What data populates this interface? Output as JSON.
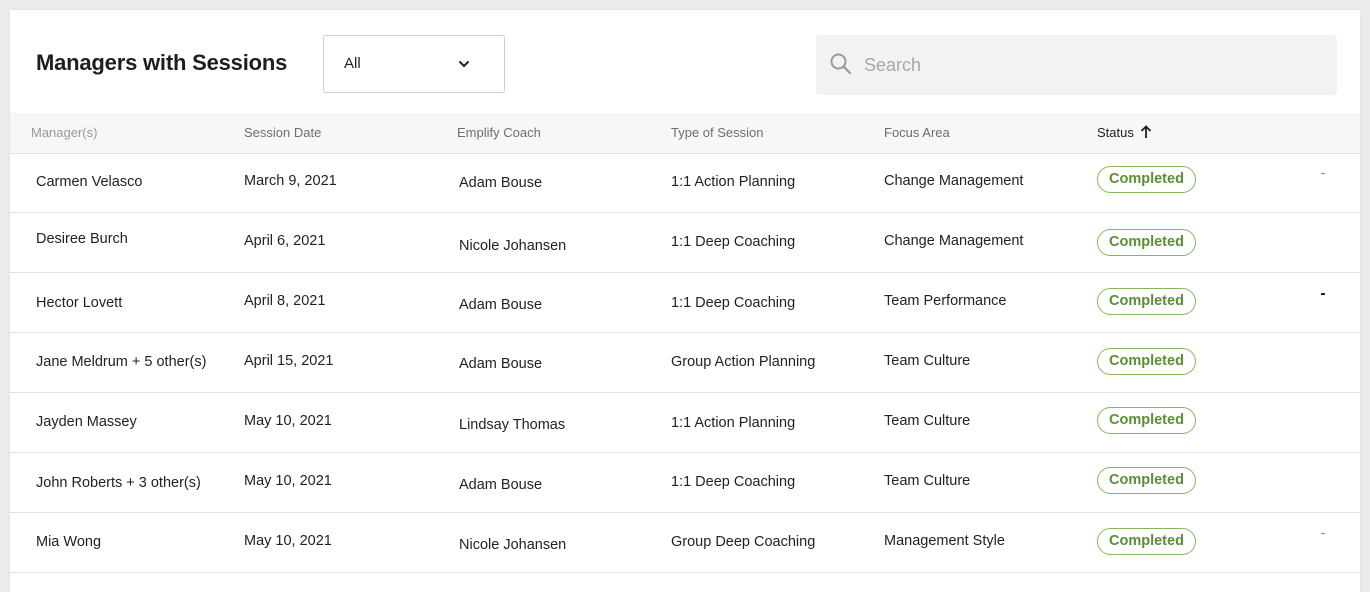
{
  "header": {
    "title": "Managers with Sessions",
    "filter": {
      "selected": "All",
      "icon": "chevron-down-icon"
    },
    "search": {
      "placeholder": "Search",
      "value": "",
      "icon": "search-icon"
    }
  },
  "table": {
    "columns": {
      "manager": "Manager(s)",
      "date": "Session Date",
      "coach": "Emplify Coach",
      "type": "Type of Session",
      "focus": "Focus Area",
      "status": "Status"
    },
    "sort": {
      "column": "status",
      "direction": "ascending",
      "icon": "arrow-up-icon"
    },
    "rows": [
      {
        "manager": "Carmen Velasco",
        "date": "March 9, 2021",
        "coach": "Adam Bouse",
        "type": "1:1 Action Planning",
        "focus": "Change Management",
        "status": "Completed"
      },
      {
        "manager": "Desiree Burch",
        "date": "April 6, 2021",
        "coach": "Nicole Johansen",
        "type": "1:1 Deep Coaching",
        "focus": "Change Management",
        "status": "Completed"
      },
      {
        "manager": "Hector Lovett",
        "date": "April 8, 2021",
        "coach": "Adam Bouse",
        "type": " 1:1 Deep Coaching",
        "focus": "Team Performance",
        "status": "Completed"
      },
      {
        "manager": "Jane Meldrum + 5 other(s)",
        "date": "April 15, 2021",
        "coach": "Adam Bouse",
        "type": "Group Action Planning",
        "focus": "Team Culture",
        "status": "Completed"
      },
      {
        "manager": "Jayden Massey",
        "date": "May 10, 2021",
        "coach": "Lindsay Thomas",
        "type": "1:1 Action Planning",
        "focus": "Team Culture",
        "status": "Completed"
      },
      {
        "manager": "John Roberts + 3 other(s)",
        "date": "May 10, 2021",
        "coach": "Adam Bouse",
        "type": "1:1 Deep Coaching",
        "focus": "Team Culture",
        "status": "Completed"
      },
      {
        "manager": "Mia Wong",
        "date": "May 10, 2021",
        "coach": "Nicole Johansen",
        "type": "Group Deep Coaching",
        "focus": "Management Style",
        "status": "Completed"
      }
    ]
  },
  "colors": {
    "status_completed": "#5b8f31",
    "status_border": "#86b95b",
    "header_bg": "#f7f7f7",
    "search_bg": "#f2f2f2"
  }
}
